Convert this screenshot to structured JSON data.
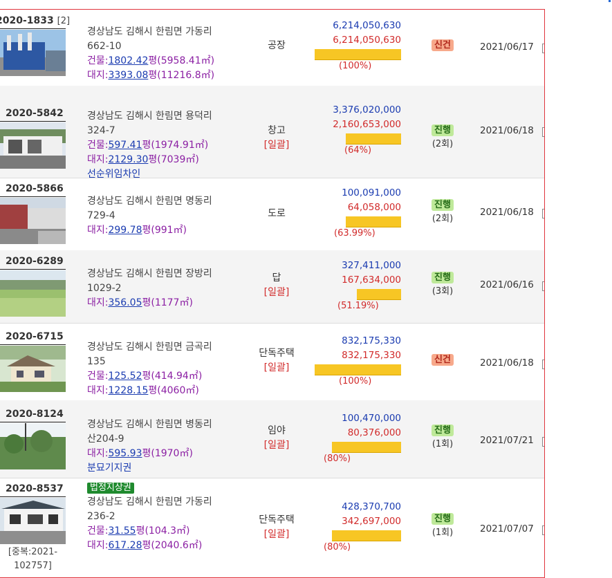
{
  "rows": [
    {
      "case": "2020-1833",
      "dup": "[2]",
      "addr1": "경상남도 김해시 한림면 가동리",
      "addr2": "662-10",
      "bld_label": "건물:",
      "bld_py": "1802.42",
      "bld_unit": "평",
      "bld_m": "(5958.41㎡)",
      "lnd_label": "대지:",
      "lnd_py": "3393.08",
      "lnd_unit": "평",
      "lnd_m": "(11216.8㎡)",
      "usage": "공장",
      "ilgwal": "",
      "appraisal": "6,214,050,630",
      "min_bid": "6,214,050,630",
      "pct": "(100%)",
      "ratio": 1.0,
      "status": "신건",
      "status_type": "new",
      "round": "",
      "date": "2021/06/17",
      "note": "",
      "tag": ""
    },
    {
      "case": "2020-5842",
      "dup": "",
      "addr1": "경상남도 김해시 한림면 용덕리",
      "addr2": "324-7",
      "bld_label": "건물:",
      "bld_py": "597.41",
      "bld_unit": "평",
      "bld_m": "(1974.91㎡)",
      "lnd_label": "대지:",
      "lnd_py": "2129.30",
      "lnd_unit": "평",
      "lnd_m": "(7039㎡)",
      "usage": "창고",
      "ilgwal": "[일괄]",
      "appraisal": "3,376,020,000",
      "min_bid": "2,160,653,000",
      "pct": "(64%)",
      "ratio": 0.64,
      "status": "진행",
      "status_type": "prog",
      "round": "(2회)",
      "date": "2021/06/18",
      "note": "선순위임차인",
      "tag": ""
    },
    {
      "case": "2020-5866",
      "dup": "",
      "addr1": "경상남도 김해시 한림면 명동리",
      "addr2": "729-4",
      "bld_label": "",
      "bld_py": "",
      "bld_unit": "",
      "bld_m": "",
      "lnd_label": "대지:",
      "lnd_py": "299.78",
      "lnd_unit": "평",
      "lnd_m": "(991㎡)",
      "usage": "도로",
      "ilgwal": "",
      "appraisal": "100,091,000",
      "min_bid": "64,058,000",
      "pct": "(63.99%)",
      "ratio": 0.6399,
      "status": "진행",
      "status_type": "prog",
      "round": "(2회)",
      "date": "2021/06/18",
      "note": "",
      "tag": ""
    },
    {
      "case": "2020-6289",
      "dup": "",
      "addr1": "경상남도 김해시 한림면 장방리",
      "addr2": "1029-2",
      "bld_label": "",
      "bld_py": "",
      "bld_unit": "",
      "bld_m": "",
      "lnd_label": "대지:",
      "lnd_py": "356.05",
      "lnd_unit": "평",
      "lnd_m": "(1177㎡)",
      "usage": "답",
      "ilgwal": "[일괄]",
      "appraisal": "327,411,000",
      "min_bid": "167,634,000",
      "pct": "(51.19%)",
      "ratio": 0.5119,
      "status": "진행",
      "status_type": "prog",
      "round": "(3회)",
      "date": "2021/06/16",
      "note": "",
      "tag": ""
    },
    {
      "case": "2020-6715",
      "dup": "",
      "addr1": "경상남도 김해시 한림면 금곡리",
      "addr2": "135",
      "bld_label": "건물:",
      "bld_py": "125.52",
      "bld_unit": "평",
      "bld_m": "(414.94㎡)",
      "lnd_label": "대지:",
      "lnd_py": "1228.15",
      "lnd_unit": "평",
      "lnd_m": "(4060㎡)",
      "usage": "단독주택",
      "ilgwal": "[일괄]",
      "appraisal": "832,175,330",
      "min_bid": "832,175,330",
      "pct": "(100%)",
      "ratio": 1.0,
      "status": "신건",
      "status_type": "new",
      "round": "",
      "date": "2021/06/18",
      "note": "",
      "tag": ""
    },
    {
      "case": "2020-8124",
      "dup": "",
      "addr1": "경상남도 김해시 한림면 병동리",
      "addr2": "산204-9",
      "bld_label": "",
      "bld_py": "",
      "bld_unit": "",
      "bld_m": "",
      "lnd_label": "대지:",
      "lnd_py": "595.93",
      "lnd_unit": "평",
      "lnd_m": "(1970㎡)",
      "usage": "임야",
      "ilgwal": "[일괄]",
      "appraisal": "100,470,000",
      "min_bid": "80,376,000",
      "pct": "(80%)",
      "ratio": 0.8,
      "status": "진행",
      "status_type": "prog",
      "round": "(1회)",
      "date": "2021/07/21",
      "note": "분묘기지권",
      "tag": ""
    },
    {
      "case": "2020-8537",
      "dup": "",
      "addr1": "경상남도 김해시 한림면 가동리",
      "addr2": "236-2",
      "bld_label": "건물:",
      "bld_py": "31.55",
      "bld_unit": "평",
      "bld_m": "(104.3㎡)",
      "lnd_label": "대지:",
      "lnd_py": "617.28",
      "lnd_unit": "평",
      "lnd_m": "(2040.6㎡)",
      "usage": "단독주택",
      "ilgwal": "[일괄]",
      "appraisal": "428,370,700",
      "min_bid": "342,697,000",
      "pct": "(80%)",
      "ratio": 0.8,
      "status": "진행",
      "status_type": "prog",
      "round": "(1회)",
      "date": "2021/07/07",
      "note": "",
      "tag": "법정지상권",
      "dup_note": "[중복:2021-102757]"
    }
  ]
}
